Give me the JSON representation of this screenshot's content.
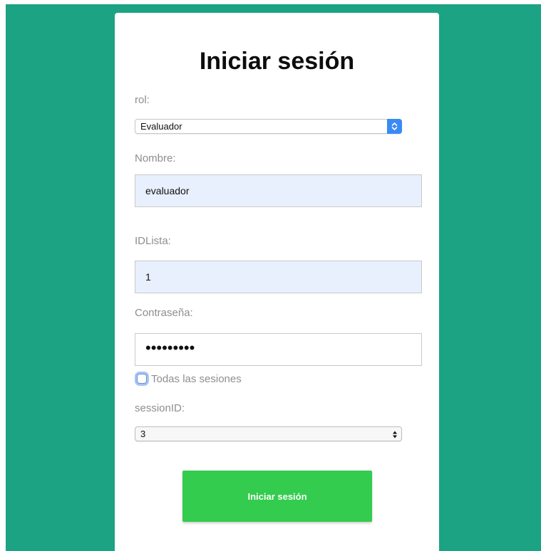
{
  "form": {
    "title": "Iniciar sesión",
    "role": {
      "label": "rol:",
      "value": "Evaluador"
    },
    "name": {
      "label": "Nombre:",
      "value": "evaluador"
    },
    "list_id": {
      "label": "IDLista:",
      "value": "1"
    },
    "password": {
      "label": "Contraseña:",
      "masked_value": "•••••••••"
    },
    "all_sessions": {
      "label": "Todas las sesiones",
      "checked": false
    },
    "session_id": {
      "label": "sessionID:",
      "value": "3"
    },
    "submit_label": "Iniciar sesión"
  },
  "colors": {
    "background": "#1ba383",
    "card": "#ffffff",
    "submit": "#33cc4f",
    "autofill": "#e8f0fe",
    "select_accent": "#3a8af5"
  },
  "icons": {
    "role_select": "updown-chevron-icon",
    "session_select": "updown-triangle-icon"
  }
}
